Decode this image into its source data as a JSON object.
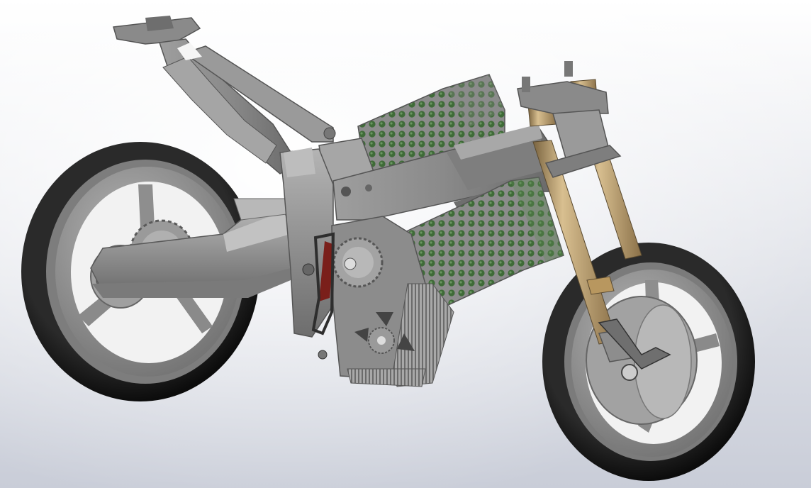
{
  "viewport": {
    "background_top": "#ffffff",
    "background_bottom": "#c9cdd8"
  },
  "colors": {
    "tire": "#151515",
    "rim": "#9a9a9a",
    "frame": "#8f8f8f",
    "frame_dark": "#5d5d5d",
    "battery_cell": "#3f6b38",
    "battery_frame": "#8c8c8c",
    "fork_gold": "#b9996a",
    "brake_caliper": "#7a1f1a"
  },
  "icons": {
    "model": "electric-motorcycle-cad-model-icon"
  }
}
